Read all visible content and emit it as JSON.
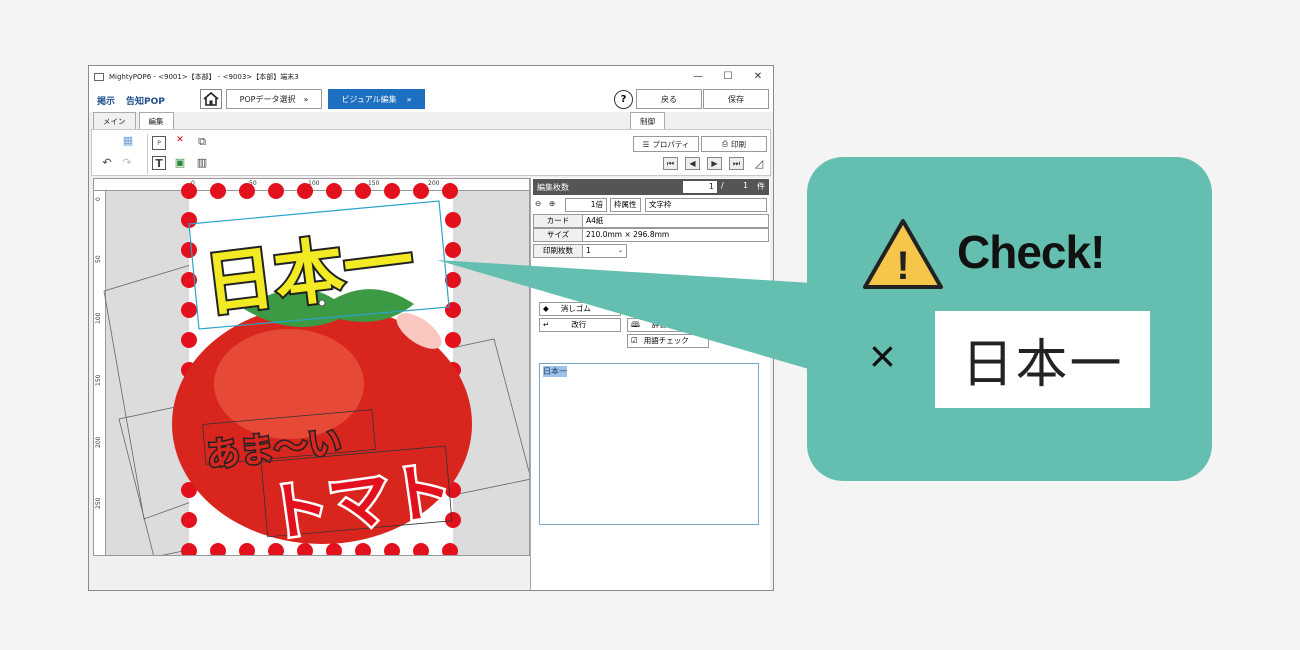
{
  "window": {
    "title": "MightyPOP6 - <9001>【本部】 - <9003>【本部】端末3",
    "minimize": "—",
    "maximize": "☐",
    "close": "✕"
  },
  "nav": {
    "link1": "掲示",
    "link2": "告知POP",
    "step1": "POPデータ選択",
    "step2": "ビジュアル編集",
    "help": "?",
    "back": "戻る",
    "save": "保存"
  },
  "tabs": {
    "main": "メイン",
    "edit": "編集",
    "control": "制御"
  },
  "ribbon": {
    "properties": "プロパティ",
    "print": "印刷"
  },
  "ruler": {
    "top": [
      "0",
      "50",
      "100",
      "150",
      "200"
    ],
    "left": [
      "0",
      "50",
      "100",
      "150",
      "200",
      "250"
    ]
  },
  "panel": {
    "header": "編集枚数",
    "current": "1",
    "slash": "/",
    "total": "1",
    "unit": "件",
    "zoom": "1倍",
    "frame_attr": "枠属性",
    "frame_type": "文字枠",
    "rows": [
      {
        "key": "カード",
        "value": "A4紙"
      },
      {
        "key": "サイズ",
        "value": "210.0mm × 296.8mm"
      },
      {
        "key": "印刷枚数",
        "value": "1"
      }
    ],
    "eraser": "消しゴム",
    "newline": "改行",
    "dictionary": "辞書",
    "term_check": "用語チェック",
    "text_value": "日本一"
  },
  "pop": {
    "headline": "日本一",
    "sub": "あま〜い",
    "main": "トマト"
  },
  "callout": {
    "title": "Check!",
    "cross": "×",
    "word": "日本一"
  },
  "colors": {
    "accent_blue": "#1d6fc2",
    "callout_teal": "#64bfb1",
    "warning_yellow": "#f5c64a",
    "tomato_red": "#d8261f",
    "dot_red": "#e3111d"
  }
}
